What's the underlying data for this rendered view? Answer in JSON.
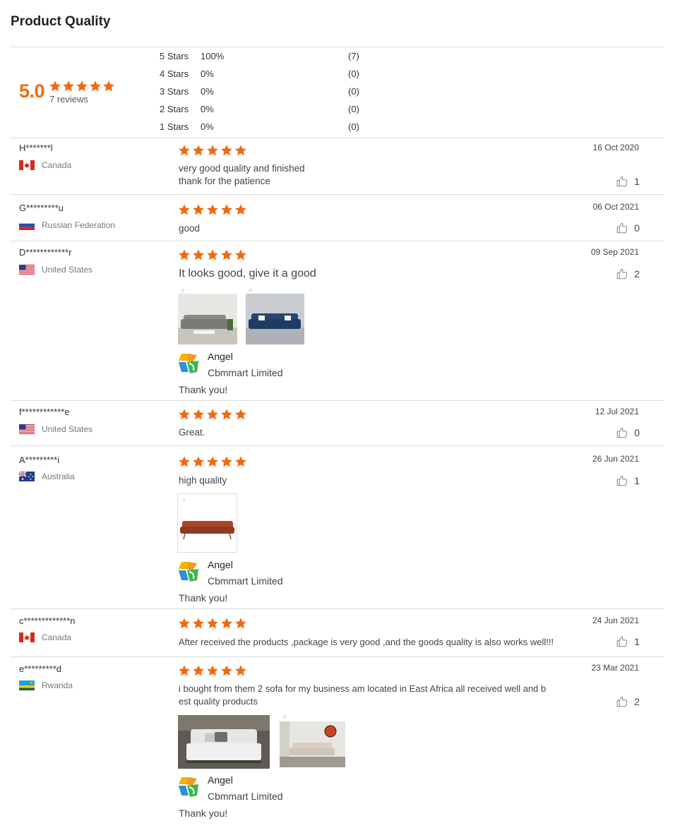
{
  "section": {
    "title": "Product Quality"
  },
  "summary": {
    "score": "5.0",
    "reviews_text": "7 reviews",
    "rating": 5,
    "distribution": [
      {
        "label": "5  Stars",
        "percent": "100%",
        "count": "(7)"
      },
      {
        "label": "4  Stars",
        "percent": "0%",
        "count": "(0)"
      },
      {
        "label": "3  Stars",
        "percent": "0%",
        "count": "(0)"
      },
      {
        "label": "2  Stars",
        "percent": "0%",
        "count": "(0)"
      },
      {
        "label": "1  Stars",
        "percent": "0%",
        "count": "(0)"
      }
    ]
  },
  "colors": {
    "accent": "#f06a10",
    "rule": "#dddddd"
  },
  "reviews": [
    {
      "reviewer": "H*******l",
      "country": "Canada",
      "date": "16 Oct 2020",
      "rating": 5,
      "text_line1": "very good quality and finished",
      "text_line2": "thank for the patience",
      "likes": "1"
    },
    {
      "reviewer": "G*********u",
      "country": "Russian Federation",
      "date": "06 Oct 2021",
      "rating": 5,
      "text_line1": "good",
      "likes": "0"
    },
    {
      "reviewer": "D************r",
      "country": "United States",
      "date": "09 Sep 2021",
      "rating": 5,
      "text_line1": "It looks good, give it a good",
      "likes": "2",
      "reply": {
        "name": "Angel",
        "company": "Cbmmart Limited",
        "text": "Thank you!"
      }
    },
    {
      "reviewer": "f************e",
      "country": "United States",
      "date": "12 Jul 2021",
      "rating": 5,
      "text_line1": "Great.",
      "likes": "0"
    },
    {
      "reviewer": "A*********i",
      "country": "Australia",
      "date": "26 Jun 2021",
      "rating": 5,
      "text_line1": "high quality",
      "likes": "1",
      "reply": {
        "name": "Angel",
        "company": "Cbmmart Limited",
        "text": "Thank you!"
      }
    },
    {
      "reviewer": "c*************n",
      "country": "Canada",
      "date": "24 Jun 2021",
      "rating": 5,
      "text_line1": "After received the products ,package is very good ,and the goods quality is also works well!!!",
      "likes": "1"
    },
    {
      "reviewer": "e*********d",
      "country": "Rwanda",
      "date": "23 Mar 2021",
      "rating": 5,
      "text_line1": "i bought from them 2 sofa for my business am located in East Africa all received well and b",
      "text_line2": "est quality products",
      "likes": "2",
      "reply": {
        "name": "Angel",
        "company": "Cbmmart Limited",
        "text": "Thank you!"
      }
    }
  ]
}
